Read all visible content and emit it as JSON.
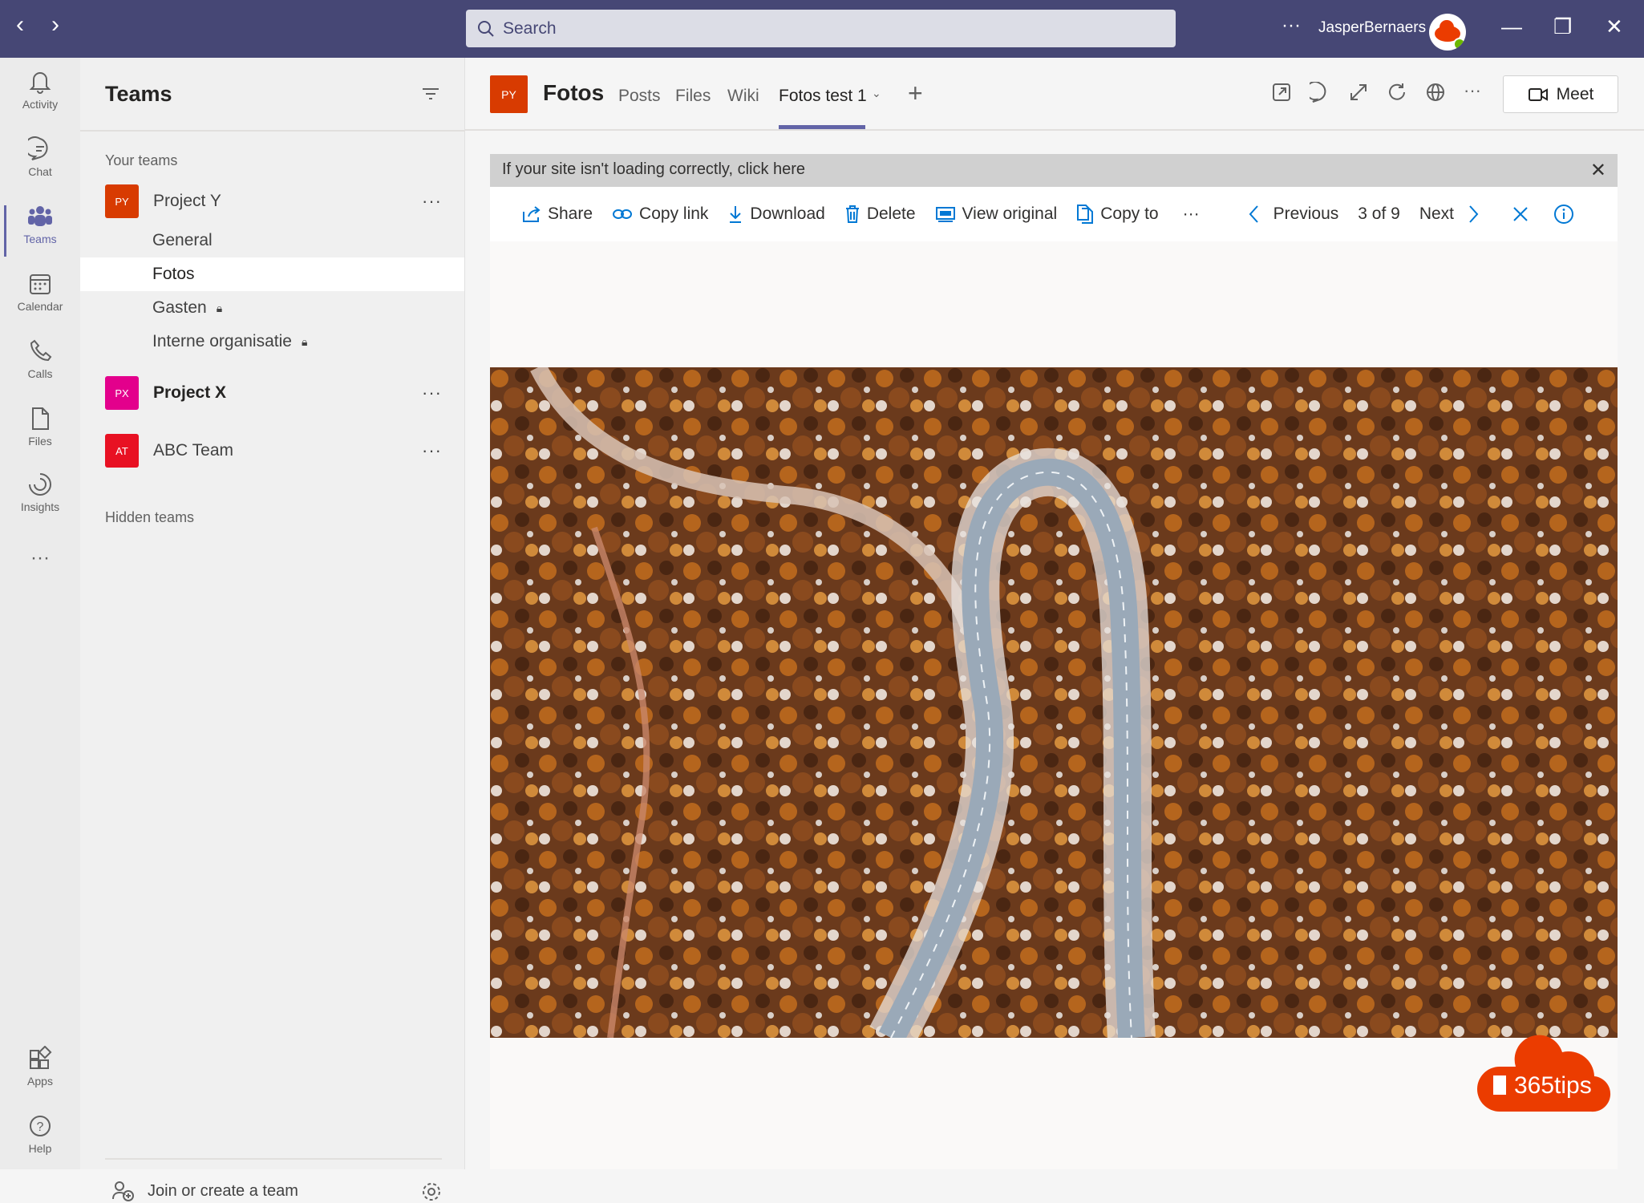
{
  "titlebar": {
    "search_placeholder": "Search",
    "user_name": "JasperBernaers",
    "more": "···"
  },
  "rail": {
    "items": [
      {
        "label": "Activity"
      },
      {
        "label": "Chat"
      },
      {
        "label": "Teams"
      },
      {
        "label": "Calendar"
      },
      {
        "label": "Calls"
      },
      {
        "label": "Files"
      },
      {
        "label": "Insights"
      },
      {
        "label": "Apps"
      },
      {
        "label": "Help"
      }
    ],
    "more": "···",
    "active": "Teams"
  },
  "panel": {
    "title": "Teams",
    "your_teams": "Your teams",
    "hidden_teams": "Hidden teams",
    "join": "Join or create a team",
    "teams": [
      {
        "initials": "PY",
        "name": "Project Y",
        "color": "#d83b01",
        "channels": [
          {
            "name": "General"
          },
          {
            "name": "Fotos",
            "selected": true
          },
          {
            "name": "Gasten",
            "private": true
          },
          {
            "name": "Interne organisatie",
            "private": true
          }
        ]
      },
      {
        "initials": "PX",
        "name": "Project X",
        "color": "#e3008c"
      },
      {
        "initials": "AT",
        "name": "ABC Team",
        "color": "#e81123"
      }
    ]
  },
  "header": {
    "badge": "PY",
    "channel": "Fotos",
    "tabs": [
      "Posts",
      "Files",
      "Wiki",
      "Fotos test 1"
    ],
    "active_tab": "Fotos test 1",
    "add": "+",
    "meet": "Meet"
  },
  "viewer": {
    "banner": "If your site isn't loading correctly, click here",
    "actions": {
      "share": "Share",
      "copy_link": "Copy link",
      "download": "Download",
      "delete": "Delete",
      "view_original": "View original",
      "copy_to": "Copy to",
      "more": "···"
    },
    "nav": {
      "previous": "Previous",
      "position": "3 of 9",
      "next": "Next"
    },
    "accent": "#0078d4"
  },
  "watermark": {
    "text": "365tips",
    "color": "#eb3c00"
  }
}
